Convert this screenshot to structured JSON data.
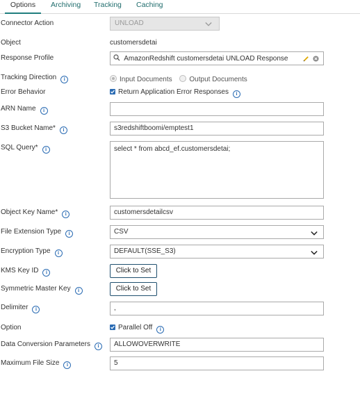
{
  "tabs": [
    {
      "label": "Options",
      "active": true
    },
    {
      "label": "Archiving",
      "active": false
    },
    {
      "label": "Tracking",
      "active": false
    },
    {
      "label": "Caching",
      "active": false
    }
  ],
  "form": {
    "connector_action": {
      "label": "Connector Action",
      "value": "UNLOAD"
    },
    "object": {
      "label": "Object",
      "value": "customersdetai"
    },
    "response_profile": {
      "label": "Response Profile",
      "value": "AmazonRedshift customersdetai UNLOAD Response"
    },
    "tracking_direction": {
      "label": "Tracking Direction",
      "option1": "Input Documents",
      "option2": "Output Documents",
      "selected": "Input Documents"
    },
    "error_behavior": {
      "label": "Error Behavior",
      "checkbox_label": "Return Application Error Responses",
      "checked": true
    },
    "arn_name": {
      "label": "ARN Name",
      "value": ""
    },
    "s3_bucket_name": {
      "label": "S3 Bucket Name*",
      "value": "s3redshiftboomi/emptest1"
    },
    "sql_query": {
      "label": "SQL Query*",
      "value": "select * from abcd_ef.customersdetai;"
    },
    "object_key_name": {
      "label": "Object Key Name*",
      "value": "customersdetailcsv"
    },
    "file_extension_type": {
      "label": "File Extension Type",
      "value": "CSV"
    },
    "encryption_type": {
      "label": "Encryption Type",
      "value": "DEFAULT(SSE_S3)"
    },
    "kms_key_id": {
      "label": "KMS Key ID",
      "button": "Click to Set"
    },
    "symmetric_master_key": {
      "label": "Symmetric Master Key",
      "button": "Click to Set"
    },
    "delimiter": {
      "label": "Delimiter",
      "value": ","
    },
    "option": {
      "label": "Option",
      "checkbox_label": "Parallel Off",
      "checked": true
    },
    "data_conversion_parameters": {
      "label": "Data Conversion Parameters",
      "value": "ALLOWOVERWRITE"
    },
    "maximum_file_size": {
      "label": "Maximum File Size",
      "value": "5"
    }
  },
  "colors": {
    "accent": "#1f7e7e",
    "info": "#2a6bb3",
    "edit": "#e0a800"
  }
}
